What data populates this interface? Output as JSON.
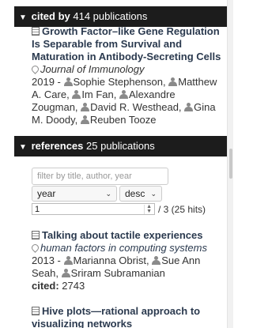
{
  "cited_by": {
    "header_bold": "cited by",
    "header_rest": " 414 publications",
    "item": {
      "title": "Growth Factor–like Gene Regulation Is Separable from Survival and Maturation in Antibody-Secreting Cells",
      "venue": "Journal of Immunology",
      "year": "2019 -",
      "authors": [
        "Sophie Stephenson,",
        "Matthew A. Care,",
        "Im Fan,",
        "Alexandre Zougman,",
        "David R. Westhead,",
        "Gina M. Doody,",
        "Reuben Tooze"
      ]
    }
  },
  "references": {
    "header_bold": "references",
    "header_rest": " 25 publications",
    "filter_placeholder": "filter by title, author, year",
    "sort_field": "year",
    "sort_order": "desc",
    "page_value": "1",
    "pages_text": "/ 3 (25 hits)",
    "items": [
      {
        "title": "Talking about tactile experiences",
        "venue": "human factors in computing systems",
        "year": "2013 -",
        "authors": [
          "Marianna Obrist,",
          "Sue Ann Seah,",
          "Sriram Subramanian"
        ],
        "cited_label": "cited:",
        "cited_value": " 2743"
      },
      {
        "title": "Hive plots—rational approach to visualizing networks"
      }
    ]
  }
}
